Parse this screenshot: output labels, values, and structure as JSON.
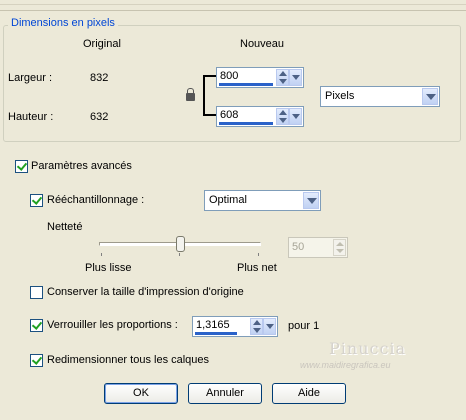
{
  "group": {
    "title": "Dimensions en pixels"
  },
  "columns": {
    "original": "Original",
    "new": "Nouveau"
  },
  "width": {
    "label": "Largeur :",
    "original": "832",
    "value": "800"
  },
  "height": {
    "label": "Hauteur :",
    "original": "632",
    "value": "608"
  },
  "units": {
    "selected": "Pixels"
  },
  "advanced": {
    "label": "Paramètres avancés",
    "checked": true
  },
  "resample": {
    "label": "Rééchantillonnage :",
    "checked": true,
    "method": "Optimal"
  },
  "sharpness": {
    "label": "Netteté",
    "value": "50",
    "min_label": "Plus lisse",
    "max_label": "Plus net",
    "level_fraction": 0.5
  },
  "keep_print_size": {
    "label": "Conserver la taille d'impression d'origine",
    "checked": false
  },
  "lock_ratio": {
    "label": "Verrouiller les proportions :",
    "checked": true,
    "value": "1,3165",
    "suffix": "pour 1"
  },
  "resize_layers": {
    "label": "Redimensionner tous les calques",
    "checked": true
  },
  "buttons": {
    "ok": "OK",
    "cancel": "Annuler",
    "help": "Aide"
  },
  "watermark": {
    "name": "Pinuccia",
    "url": "www.maidiregrafica.eu"
  },
  "icons": {
    "lock": "lock-icon",
    "check": "check-icon",
    "dropdown": "chevron-down-icon",
    "spin": "spin-arrows-icon"
  }
}
